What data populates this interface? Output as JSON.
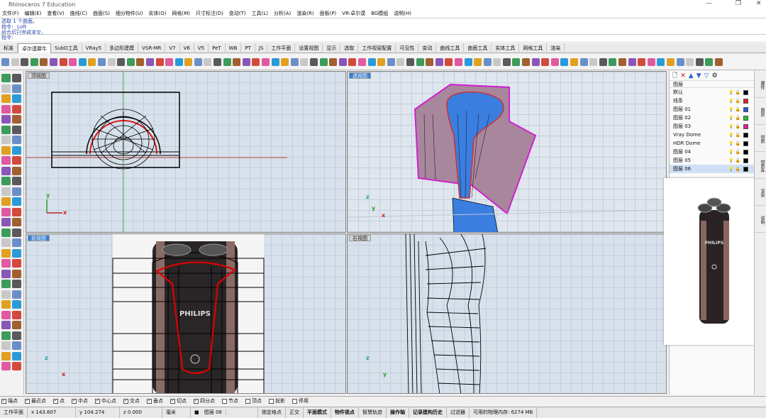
{
  "window": {
    "title": "Rhinoceros 7 Education"
  },
  "menu": [
    "文件(F)",
    "编辑(E)",
    "查看(V)",
    "曲线(C)",
    "曲面(S)",
    "细分物件(U)",
    "实体(O)",
    "网格(M)",
    "尺寸标注(D)",
    "变动(T)",
    "工具(L)",
    "分析(A)",
    "渲染(R)",
    "面板(P)",
    "VR-卓尔谟",
    "BG模组",
    "说明(H)"
  ],
  "history": [
    "选取 1 个曲面。",
    "指令: _Loft",
    "组合后已完成求交。"
  ],
  "command": {
    "label": "指令:"
  },
  "tabs": [
    "标准",
    "卓尔谟犀牛",
    "SubD工具",
    "VRay5",
    "多边形建模",
    "VSR-MR",
    "V7",
    "V6",
    "V5",
    "PeT",
    "WB",
    "PT",
    "JS",
    "工作平面",
    "设置视图",
    "显示",
    "选取",
    "工作视窗配置",
    "可见性",
    "变动",
    "曲线工具",
    "曲面工具",
    "实体工具",
    "网格工具",
    "渲染"
  ],
  "active_tab": "卓尔谟犀牛",
  "viewports": {
    "top": {
      "label": "顶视图"
    },
    "perspective": {
      "label": "透视图"
    },
    "front": {
      "label": "前视图"
    },
    "right": {
      "label": "右视图"
    }
  },
  "layers_panel": {
    "header": "图层",
    "layers": [
      {
        "name": "默认",
        "color": "#000000"
      },
      {
        "name": "线条",
        "color": "#e02020"
      },
      {
        "name": "图层 01",
        "color": "#1e5adf"
      },
      {
        "name": "图层 02",
        "color": "#22c022"
      },
      {
        "name": "图层 03",
        "color": "#e01e9a"
      },
      {
        "name": "Vray Dome",
        "color": "#000000"
      },
      {
        "name": "HDR Dome",
        "color": "#000000"
      },
      {
        "name": "图层 04",
        "color": "#000000"
      },
      {
        "name": "图层 05",
        "color": "#000000"
      },
      {
        "name": "图层 06",
        "color": "#000000"
      }
    ]
  },
  "preview": {
    "brand": "PHILIPS"
  },
  "right_tabs": [
    "属性",
    "图层",
    "材质",
    "材质库",
    "渲染",
    "说明"
  ],
  "osnaps": [
    {
      "label": "端点",
      "checked": true
    },
    {
      "label": "最近点",
      "checked": true
    },
    {
      "label": "点",
      "checked": true
    },
    {
      "label": "中点",
      "checked": true
    },
    {
      "label": "中心点",
      "checked": true
    },
    {
      "label": "交点",
      "checked": true
    },
    {
      "label": "垂点",
      "checked": true
    },
    {
      "label": "切点",
      "checked": true
    },
    {
      "label": "四分点",
      "checked": true
    },
    {
      "label": "节点",
      "checked": false
    },
    {
      "label": "顶点",
      "checked": false
    },
    {
      "label": "投影",
      "checked": false
    },
    {
      "label": "停用",
      "checked": false
    }
  ],
  "status": {
    "cplane": "工作平面",
    "x": "x 143.607",
    "y": "y 104.274",
    "z": "z 0.000",
    "unit": "毫米",
    "layer": "图层 06",
    "toggles": [
      "锁定格点",
      "正交",
      "平面模式",
      "物件锁点",
      "智慧轨迹",
      "操作轴",
      "记录建构历史",
      "过滤器"
    ],
    "memory": "可用的物理内存: 6274 MB"
  }
}
